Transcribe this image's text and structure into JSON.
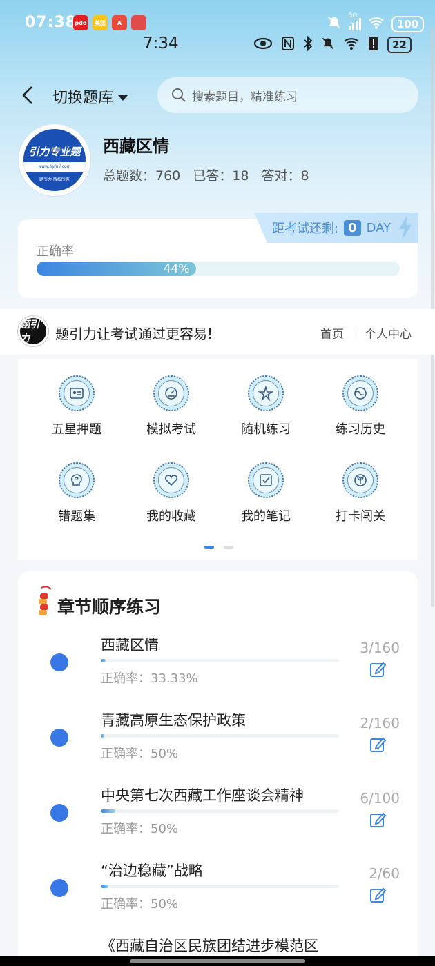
{
  "status_outer": {
    "time": "07:38",
    "app_icons": [
      {
        "name": "pinduoduo-app-icon",
        "label": "pdd",
        "color": "#e02020"
      },
      {
        "name": "meituan-app-icon",
        "label": "美团",
        "color": "#f7c31c"
      },
      {
        "name": "app-icon-a",
        "label": "A",
        "color": "#e84a3c"
      },
      {
        "name": "app-icon-b",
        "label": "",
        "color": "#e14b4b"
      }
    ],
    "signal_label": "5G",
    "battery": "100"
  },
  "status_inner": {
    "time": "7:34",
    "battery": "22"
  },
  "header": {
    "switch_label": "切换题库",
    "search_placeholder": "搜索题目，精准练习"
  },
  "subject": {
    "logo_title": "引力专业题",
    "logo_url": "www.tiyinli.com",
    "logo_rights": "题引力 版权所有",
    "title": "西藏区情",
    "total_label": "总题数：760",
    "answered_label": "已答：18",
    "correct_label": "答对：8"
  },
  "accuracy": {
    "label": "正确率",
    "percent_text": "44%",
    "percent": 44,
    "countdown_label": "距考试还剩:",
    "countdown_value": "0",
    "countdown_unit": "DAY"
  },
  "slogan": {
    "logo_text": "题引力",
    "text": "题引力让考试通过更容易!",
    "nav_home": "首页",
    "nav_me": "个人中心"
  },
  "functions": [
    {
      "label": "五星押题",
      "icon": "id-card-icon"
    },
    {
      "label": "模拟考试",
      "icon": "speedometer-icon"
    },
    {
      "label": "随机练习",
      "icon": "shuffle-star-icon"
    },
    {
      "label": "练习历史",
      "icon": "globe-history-icon"
    },
    {
      "label": "错题集",
      "icon": "brain-icon"
    },
    {
      "label": "我的收藏",
      "icon": "heart-icon"
    },
    {
      "label": "我的笔记",
      "icon": "checkbox-note-icon"
    },
    {
      "label": "打卡闯关",
      "icon": "sprout-icon"
    }
  ],
  "chapter": {
    "title": "章节顺序练习",
    "rows": [
      {
        "name": "西藏区情",
        "acc": "正确率：33.33%",
        "count": "3/160",
        "progress": 0.019
      },
      {
        "name": "青藏高原生态保护政策",
        "acc": "正确率：50%",
        "count": "2/160",
        "progress": 0.013
      },
      {
        "name": "中央第七次西藏工作座谈会精神",
        "acc": "正确率：50%",
        "count": "6/100",
        "progress": 0.06
      },
      {
        "name": "“治边稳藏”战略",
        "acc": "正确率：50%",
        "count": "2/60",
        "progress": 0.033
      },
      {
        "name": "《西藏自治区民族团结进步模范区",
        "acc": "",
        "count": "",
        "progress": 0
      }
    ]
  }
}
